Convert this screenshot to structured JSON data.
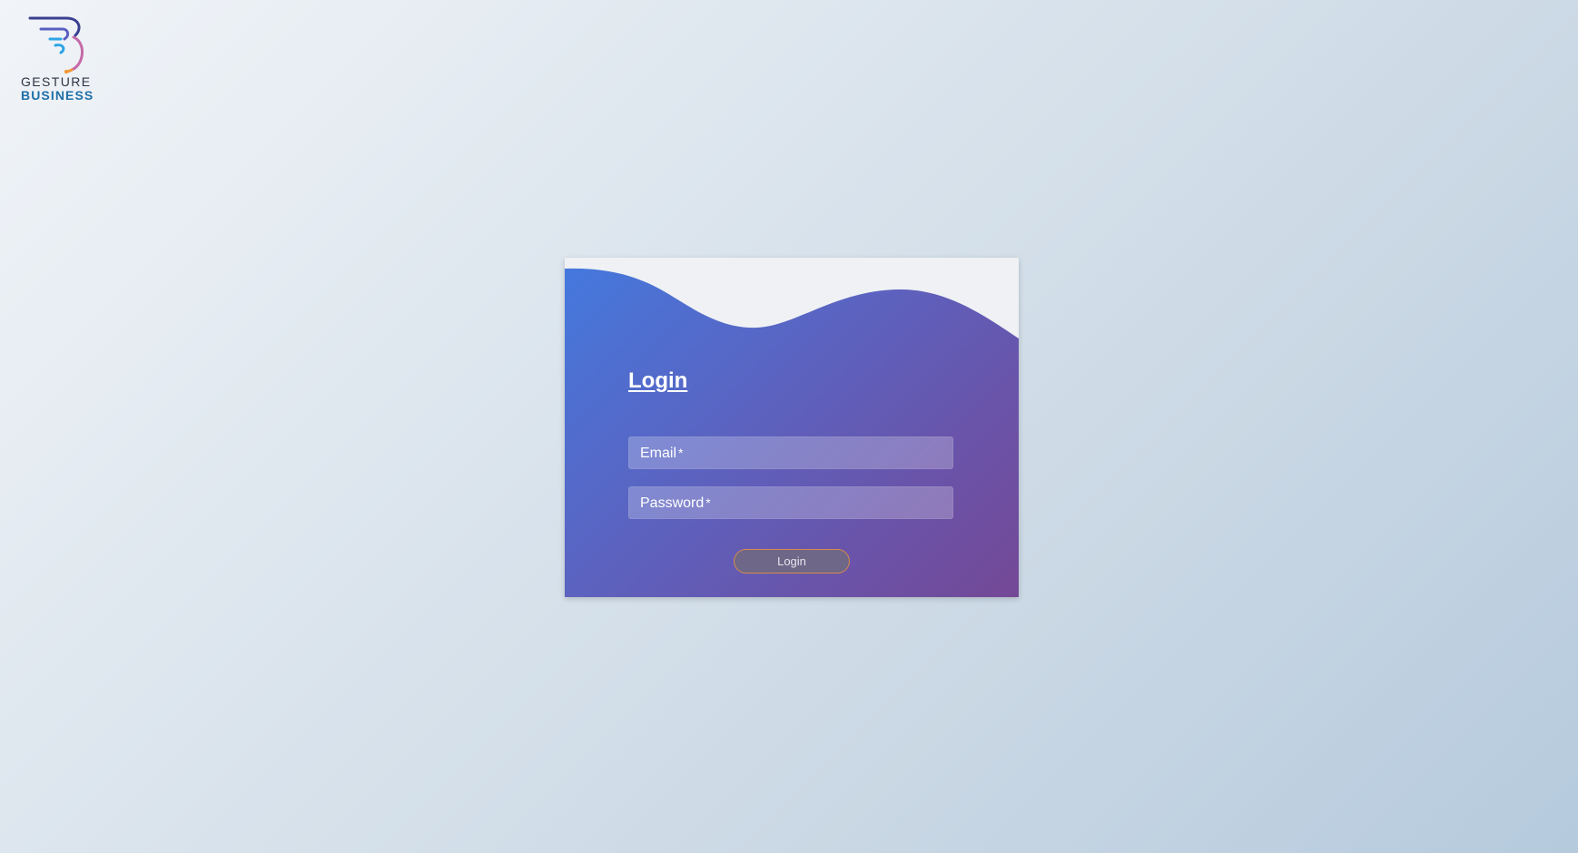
{
  "brand": {
    "icon": "gesture-b-logo-icon",
    "line1": "GESTURE",
    "line2": "BUSINESS",
    "colors": {
      "line1": "#2f3342",
      "line2": "#1f6fa8",
      "mark_dark": "#3a3f8f",
      "mark_blue": "#2ea3e6",
      "mark_orange": "#f39a3a"
    }
  },
  "login_card": {
    "title": "Login",
    "fields": {
      "email": {
        "label": "Email",
        "required_mark": "*",
        "value": ""
      },
      "password": {
        "label": "Password",
        "required_mark": "*",
        "value": ""
      }
    },
    "submit_label": "Login",
    "colors": {
      "gradient_start": "#4479de",
      "gradient_end": "#744896",
      "wave_fill": "#eff1f4",
      "button_border": "#d98a4c",
      "button_fill": "#6e6787"
    }
  }
}
